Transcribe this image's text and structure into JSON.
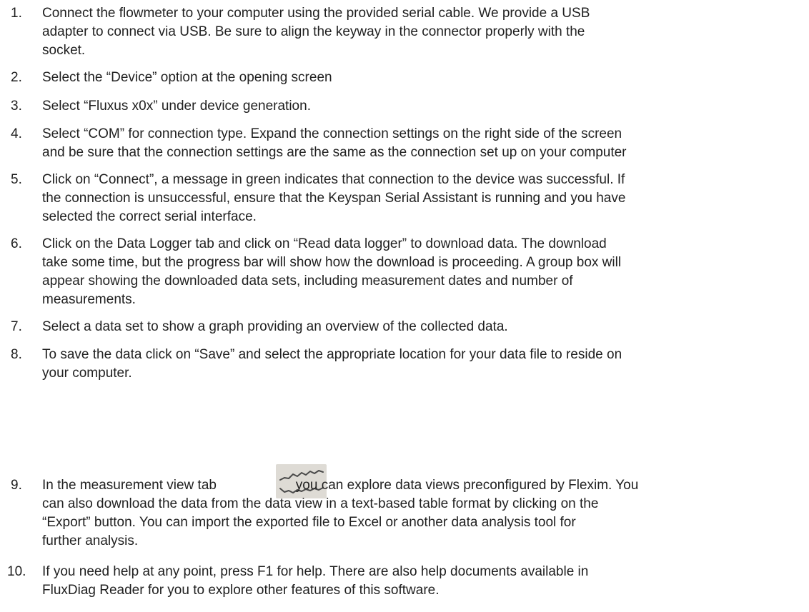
{
  "steps": [
    {
      "number": "1.",
      "lines": [
        "Connect the flowmeter to your computer using the provided serial cable. We provide a USB",
        "adapter to connect via USB. Be sure to align the keyway in the connector properly with the",
        "socket."
      ]
    },
    {
      "number": "2.",
      "lines": [
        "Select the  “Device” option at the opening screen"
      ]
    },
    {
      "number": "3.",
      "lines": [
        "Select “Fluxus x0x”  under device generation."
      ]
    },
    {
      "number": "4.",
      "lines": [
        "Select “COM” for connection type. Expand the connection settings on the right side of the screen",
        "and be sure that the connection settings are the same as the connection set up on your computer"
      ]
    },
    {
      "number": "5.",
      "lines": [
        "Click on “Connect”, a message in green indicates that connection to the device was successful. If",
        "the connection is unsuccessful, ensure that the Keyspan Serial Assistant is running and you have",
        "selected the correct serial interface."
      ]
    },
    {
      "number": "6.",
      "lines": [
        "Click on the Data Logger tab and click on “Read data logger” to download data. The download",
        "take some time, but the progress bar will show how the download is proceeding. A group box will",
        "appear showing the downloaded data sets, including measurement dates and number of",
        "measurements."
      ]
    },
    {
      "number": "7.",
      "lines": [
        "Select a data set to show a graph providing an overview of the collected data."
      ]
    },
    {
      "number": "8.",
      "lines": [
        "To save the data click on “Save” and select the appropriate location for your data file to reside on",
        "your computer."
      ]
    },
    {
      "number": "9.",
      "lines": [
        "In the measurement view tab                     you can explore data views preconfigured by Flexim. You",
        "can also download the data from the data view in a text-based table  format by clicking on the",
        "“Export”  button. You can import the exported file to Excel or another data analysis tool for",
        "further analysis."
      ]
    },
    {
      "number": "10.",
      "lines": [
        "If you need help at any point, press F1 for help. There are also help documents available in",
        "FluxDiag Reader for you to explore other features of this software."
      ]
    }
  ],
  "icons": {
    "measurement_view_tab": "measurement-view-chart-icon"
  }
}
